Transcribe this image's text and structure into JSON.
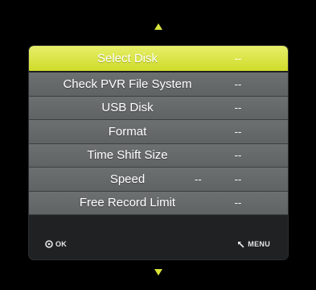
{
  "nav": {
    "up_icon": "triangle-up-icon",
    "down_icon": "triangle-down-icon",
    "accent_color": "#d8e43a"
  },
  "menu": {
    "items": [
      {
        "label": "Select Disk",
        "value": "--",
        "selected": true
      },
      {
        "label": "Check PVR File System",
        "value": "--"
      },
      {
        "label": "USB Disk",
        "value": "--"
      },
      {
        "label": "Format",
        "value": "--"
      },
      {
        "label": "Time Shift Size",
        "value": "--"
      },
      {
        "label": "Speed",
        "inline_value": "--",
        "value": "--"
      },
      {
        "label": "Free Record Limit",
        "value": "--"
      }
    ]
  },
  "footer": {
    "ok_label": "OK",
    "ok_icon": "ok-button-icon",
    "menu_label": "MENU",
    "menu_icon": "return-arrow-icon"
  }
}
